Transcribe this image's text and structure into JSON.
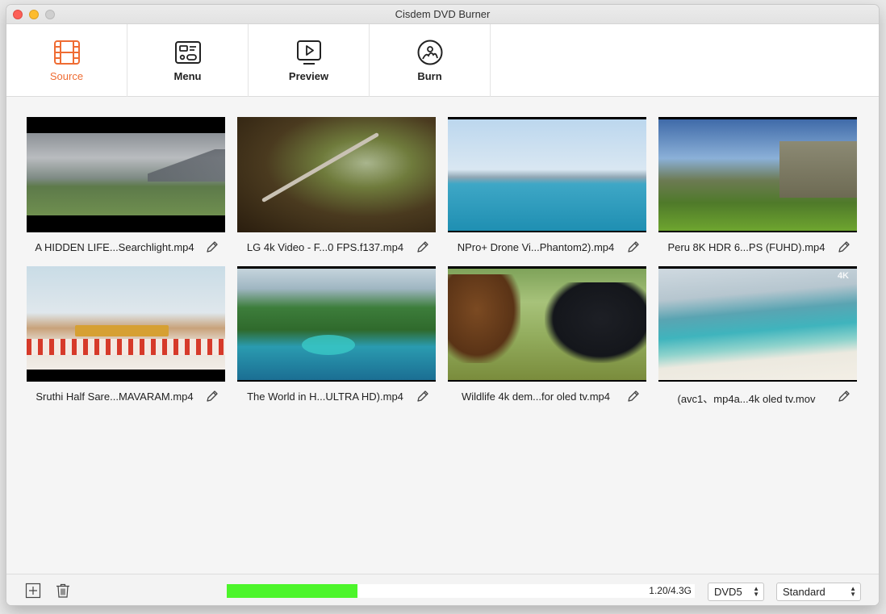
{
  "window": {
    "title": "Cisdem DVD Burner"
  },
  "toolbar": {
    "tabs": [
      {
        "label": "Source",
        "active": true,
        "icon": "film-icon"
      },
      {
        "label": "Menu",
        "active": false,
        "icon": "menu-layout-icon"
      },
      {
        "label": "Preview",
        "active": false,
        "icon": "play-screen-icon"
      },
      {
        "label": "Burn",
        "active": false,
        "icon": "disc-icon"
      }
    ],
    "accent_color": "#ef6c33"
  },
  "videos": [
    {
      "name": "A HIDDEN LIFE...Searchlight.mp4"
    },
    {
      "name": "LG 4k Video - F...0 FPS.f137.mp4"
    },
    {
      "name": "NPro+ Drone Vi...Phantom2).mp4"
    },
    {
      "name": "Peru 8K HDR 6...PS (FUHD).mp4"
    },
    {
      "name": "Sruthi Half Sare...MAVARAM.mp4"
    },
    {
      "name": "The World in H...ULTRA HD).mp4"
    },
    {
      "name": "Wildlife 4k dem...for oled tv.mp4"
    },
    {
      "name": "(avc1、mp4a...4k oled tv.mov"
    }
  ],
  "thumb_overlay_4k": "4K",
  "footer": {
    "capacity_text": "1.20/4.3G",
    "capacity_fraction": 0.279,
    "progress_color": "#4cf52a",
    "disc_type": "DVD5",
    "quality": "Standard"
  }
}
